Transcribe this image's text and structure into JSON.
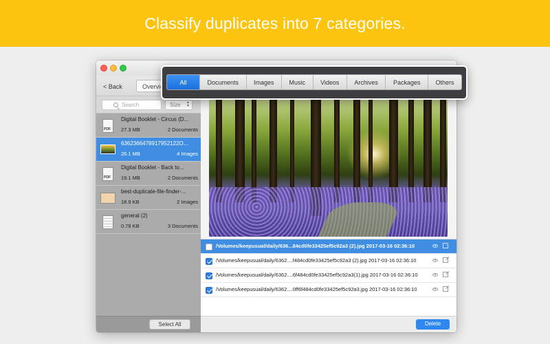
{
  "banner": {
    "text": "Classify duplicates into 7 categories."
  },
  "toolbar": {
    "back_label": "< Back",
    "overview_label": "Overview"
  },
  "search": {
    "placeholder": "Search",
    "sort_label": "Size"
  },
  "sidebar": {
    "items": [
      {
        "name": "Digital Booklet - Circus (D...",
        "size": "27.3 MB",
        "count": "2 Documents",
        "icon": "pdf-icon"
      },
      {
        "name": "6362366478917952122O...",
        "size": "26.1 MB",
        "count": "4 Images",
        "icon": "image-thumbnail-icon"
      },
      {
        "name": "Digital Booklet - Back to...",
        "size": "19.1 MB",
        "count": "2 Documents",
        "icon": "pdf-icon"
      },
      {
        "name": "best-duplicate-file-finder-...",
        "size": "18.9 KB",
        "count": "2 Images",
        "icon": "png-icon"
      },
      {
        "name": "general (2)",
        "size": "0.78 KB",
        "count": "3 Documents",
        "icon": "document-icon"
      }
    ],
    "select_all_label": "Select All"
  },
  "categories": [
    "All",
    "Documents",
    "Images",
    "Music",
    "Videos",
    "Archives",
    "Packages",
    "Others"
  ],
  "files": [
    {
      "path": "/Volumes/keepusual/daily/636...84cd0fe33425ef5c92a3  (2).jpg  2017-03-16 02:36:10",
      "checked": false
    },
    {
      "path": "/Volumes/keepusual/daily/6362....f484cd0fe33425ef5c92a3 (2).jpg  2017-03-16 02:36:10",
      "checked": true
    },
    {
      "path": "/Volumes/keepusual/daily/6362....6f484cd0fe33425ef5c92a3(1).jpg  2017-03-16 02:36:10",
      "checked": true
    },
    {
      "path": "/Volumes/keepusual/daily/6362....0ff6f484cd0fe33425ef5c92a3.jpg  2017-03-16 02:36:10",
      "checked": true
    }
  ],
  "footer": {
    "delete_label": "Delete"
  },
  "colors": {
    "banner": "#fcc40f",
    "accent": "#3f8ee4",
    "sidebar": "#ababab"
  }
}
